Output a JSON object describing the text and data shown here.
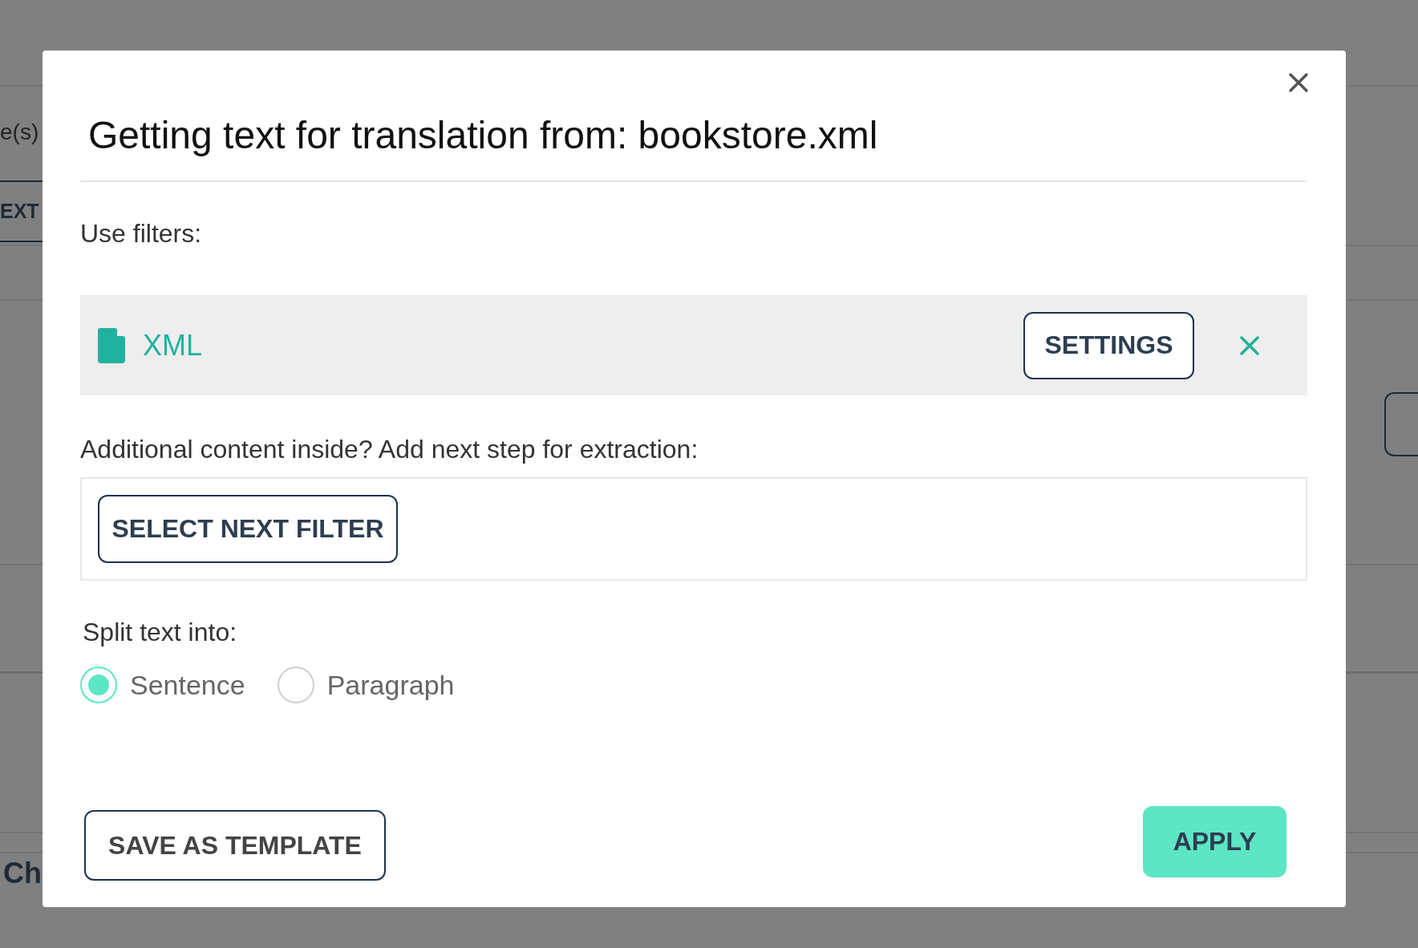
{
  "background_page": {
    "partial_label": "e(s)",
    "tab": "EXT",
    "heading": "Ch"
  },
  "dialog": {
    "title": "Getting text for translation from: bookstore.xml",
    "filters_label": "Use filters:",
    "filter": {
      "name": "XML",
      "settings_button": "SETTINGS"
    },
    "next_step_label": "Additional content inside? Add next step for extraction:",
    "next_filter_button": "SELECT NEXT FILTER",
    "split_label": "Split text into:",
    "split_options": [
      {
        "label": "Sentence",
        "selected": true
      },
      {
        "label": "Paragraph",
        "selected": false
      }
    ],
    "save_button": "SAVE AS TEMPLATE",
    "apply_button": "APPLY"
  }
}
